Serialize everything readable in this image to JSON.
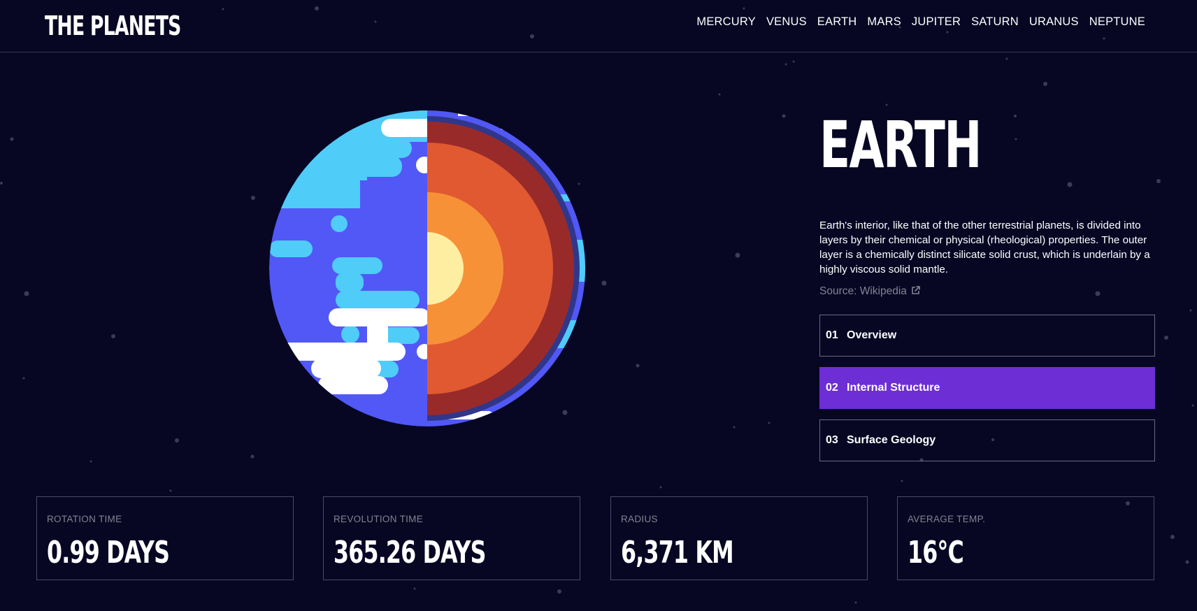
{
  "header": {
    "logo": "THE PLANETS",
    "nav": [
      "MERCURY",
      "VENUS",
      "EARTH",
      "MARS",
      "JUPITER",
      "SATURN",
      "URANUS",
      "NEPTUNE"
    ]
  },
  "planet": {
    "name": "EARTH",
    "description": "Earth's interior, like that of the other terrestrial planets, is divided into layers by their chemical or physical (rheological) properties. The outer layer is a chemically distinct silicate solid crust, which is underlain by a highly viscous solid mantle.",
    "source_label": "Source:",
    "source_link": "Wikipedia"
  },
  "tabs": [
    {
      "num": "01",
      "label": "Overview",
      "active": false
    },
    {
      "num": "02",
      "label": "Internal Structure",
      "active": true
    },
    {
      "num": "03",
      "label": "Surface Geology",
      "active": false
    }
  ],
  "stats": [
    {
      "label": "ROTATION TIME",
      "value": "0.99 DAYS"
    },
    {
      "label": "REVOLUTION TIME",
      "value": "365.26 DAYS"
    },
    {
      "label": "RADIUS",
      "value": "6,371 KM"
    },
    {
      "label": "AVERAGE TEMP.",
      "value": "16°C"
    }
  ],
  "colors": {
    "background": "#070724",
    "accent": "#6d2ed5",
    "muted_text": "#838391",
    "border": "#38384f"
  }
}
